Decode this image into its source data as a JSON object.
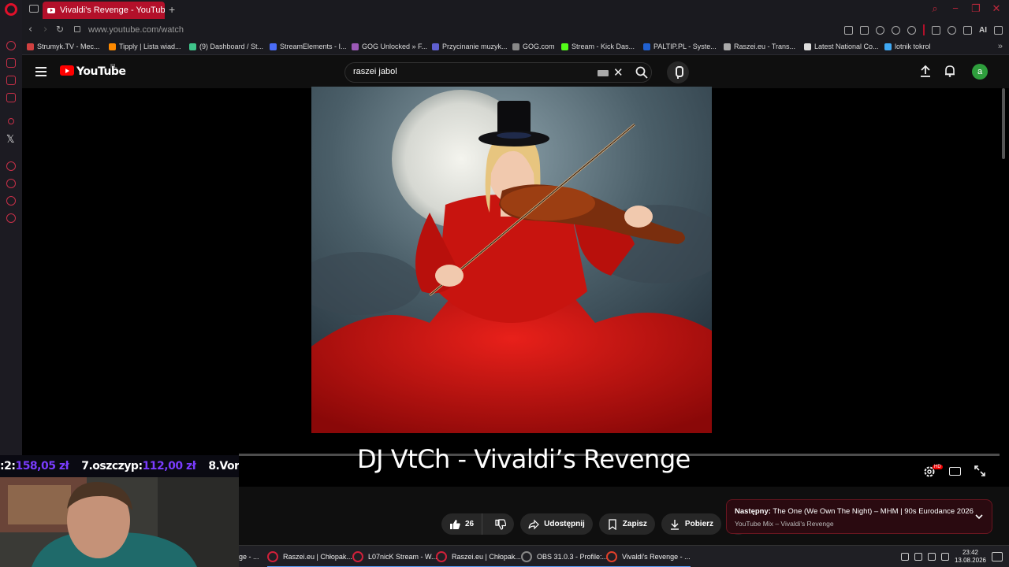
{
  "browser": {
    "active_tab_title": "Vivaldi's Revenge - YouTube",
    "new_tab_label": "+",
    "url": "www.youtube.com/watch",
    "ai_label": "AI"
  },
  "bookmarks": [
    {
      "label": "Strumyk.TV - Mec...",
      "color": "#d04040"
    },
    {
      "label": "Tipply | Lista wiad...",
      "color": "#ff8a00"
    },
    {
      "label": "(9) Dashboard / St...",
      "color": "#3fc48a"
    },
    {
      "label": "StreamElements - I...",
      "color": "#4a6cf7"
    },
    {
      "label": "GOG Unlocked » F...",
      "color": "#9b59b6"
    },
    {
      "label": "Przycinanie muzyk...",
      "color": "#6060d0"
    },
    {
      "label": "GOG.com",
      "color": "#888888"
    },
    {
      "label": "Stream - Kick Das...",
      "color": "#53fc18"
    },
    {
      "label": "PALTIP.PL - Syste...",
      "color": "#2060d0"
    },
    {
      "label": "Raszei.eu - Trans...",
      "color": "#aaaaaa"
    },
    {
      "label": "Latest National Co...",
      "color": "#dddddd"
    },
    {
      "label": "lotnik tokrol",
      "color": "#3fa9f5"
    }
  ],
  "youtube": {
    "wordmark": "YouTube",
    "country": "PL",
    "search_value": "raszei jabol",
    "avatar_letter": "a"
  },
  "video": {
    "overlay_title": "DJ VtCh - Vivaldi’s Revenge",
    "settings_badge": "HD"
  },
  "stream_overlay": {
    "ticker": [
      {
        "prefix": ":2: ",
        "amount": "158,05 zł"
      },
      {
        "prefix": "7.oszczyp: ",
        "amount": "112,00 zł"
      },
      {
        "prefix": "8.Vor",
        "amount": ""
      }
    ]
  },
  "actions": {
    "like_count": "26",
    "share_label": "Udostępnij",
    "save_label": "Zapisz",
    "download_label": "Pobierz",
    "more_label": "⋯"
  },
  "next_up": {
    "prefix": "Następny:",
    "title": " The One (We Own The Night) – MHM | 90s Eurodance 2026",
    "subtitle": "YouTube Mix – Vivaldi's Revenge"
  },
  "taskbar": {
    "items": [
      {
        "label": "ge - ...",
        "color": "#d0203a"
      },
      {
        "label": "Raszei.eu | Chłopak...",
        "color": "#d0203a"
      },
      {
        "label": "L07nicK Stream - W...",
        "color": "#d0203a"
      },
      {
        "label": "Raszei.eu | Chłopak...",
        "color": "#d0203a"
      },
      {
        "label": "OBS 31.0.3 - Profile:...",
        "color": "#888888"
      },
      {
        "label": "Vivaldi's Revenge - ...",
        "color": "#e0402a"
      }
    ],
    "time": "23:42",
    "date": "13.08.2026"
  }
}
